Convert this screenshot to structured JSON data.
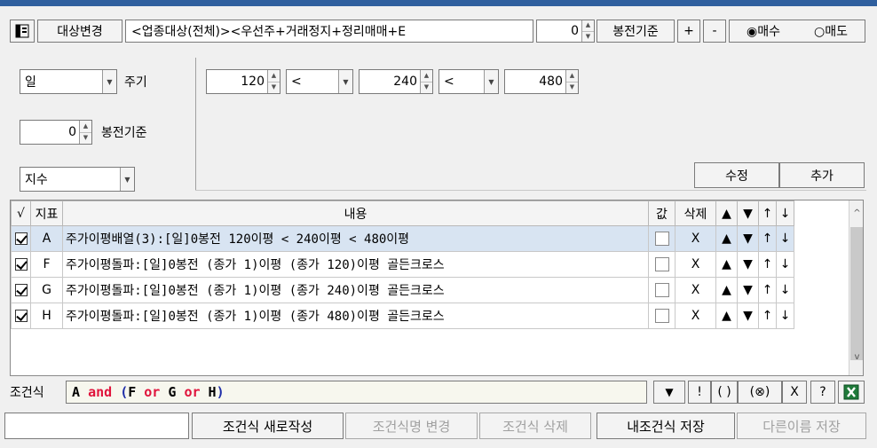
{
  "header": {
    "target_change_label": "대상변경",
    "target_text": "<업종대상(전체)><우선주+거래정지+정리매매+E",
    "prev_bong_value": "0",
    "prev_bong_label": "봉전기준",
    "plus_label": "+",
    "minus_label": "-",
    "buy_label": "◉매수",
    "sell_label": "○매도",
    "trade_side": "buy"
  },
  "settings": {
    "period_value": "일",
    "period_label": "주기",
    "bong_value": "0",
    "bong_label": "봉전기준",
    "index_value": "지수",
    "ma1": "120",
    "op1": "<",
    "ma2": "240",
    "op2": "<",
    "ma3": "480",
    "edit_label": "수정",
    "add_label": "추가"
  },
  "grid": {
    "headers": {
      "check": "√",
      "indicator": "지표",
      "content": "내용",
      "value": "값",
      "delete": "삭제",
      "up_fill": "▲",
      "down_fill": "▼",
      "up_arrow": "↑",
      "down_arrow": "↓"
    },
    "rows": [
      {
        "checked": true,
        "id": "A",
        "content": "주가이평배열(3):[일]0봉전 120이평 < 240이평 < 480이평",
        "delete": "X",
        "up": "▲",
        "down": "▼",
        "mu": "↑",
        "md": "↓",
        "selected": true
      },
      {
        "checked": true,
        "id": "F",
        "content": "주가이평돌파:[일]0봉전 (종가 1)이평 (종가 120)이평 골든크로스",
        "delete": "X",
        "up": "▲",
        "down": "▼",
        "mu": "↑",
        "md": "↓",
        "selected": false
      },
      {
        "checked": true,
        "id": "G",
        "content": "주가이평돌파:[일]0봉전 (종가 1)이평 (종가 240)이평 골든크로스",
        "delete": "X",
        "up": "▲",
        "down": "▼",
        "mu": "↑",
        "md": "↓",
        "selected": false
      },
      {
        "checked": true,
        "id": "H",
        "content": "주가이평돌파:[일]0봉전 (종가 1)이평 (종가 480)이평 골든크로스",
        "delete": "X",
        "up": "▲",
        "down": "▼",
        "mu": "↑",
        "md": "↓",
        "selected": false
      }
    ],
    "scroll_up": "^",
    "scroll_down": "v"
  },
  "condition": {
    "label": "조건식",
    "tokens": [
      {
        "t": "A",
        "c": "b"
      },
      {
        "t": " ",
        "c": "b"
      },
      {
        "t": "and",
        "c": "r"
      },
      {
        "t": " ",
        "c": "b"
      },
      {
        "t": "(",
        "c": "u"
      },
      {
        "t": "F",
        "c": "b"
      },
      {
        "t": " ",
        "c": "b"
      },
      {
        "t": "or",
        "c": "r"
      },
      {
        "t": " ",
        "c": "b"
      },
      {
        "t": "G",
        "c": "b"
      },
      {
        "t": " ",
        "c": "b"
      },
      {
        "t": "or",
        "c": "r"
      },
      {
        "t": " ",
        "c": "b"
      },
      {
        "t": "H",
        "c": "b"
      },
      {
        "t": ")",
        "c": "u"
      }
    ],
    "tools": {
      "down": "▼",
      "not": "!",
      "paren": "( )",
      "xor": "(⊗)",
      "x": "X",
      "help": "?"
    }
  },
  "footer": {
    "name_value": "",
    "new_label": "조건식 새로작성",
    "rename_label": "조건식명 변경",
    "delete_label": "조건식 삭제",
    "save_label": "내조건식 저장",
    "save_as_label": "다른이름 저장"
  },
  "colors": {
    "selected_row": "#d8e4f2",
    "and_or": "#e0143c",
    "paren": "#1f2ea8",
    "top_bar": "#2f5f9e",
    "excel": "#1f7a3a"
  }
}
